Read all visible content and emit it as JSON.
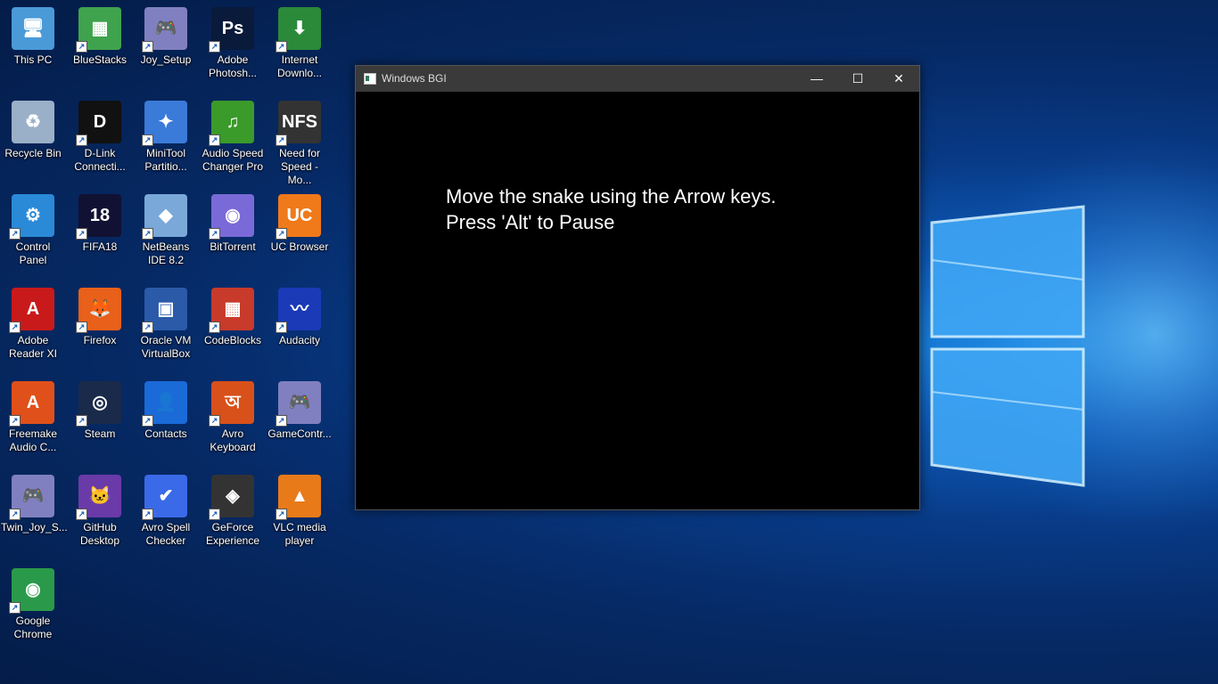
{
  "colors": {
    "desktop_bg": "#083a86",
    "window_bg": "#000000",
    "titlebar": "#3a3a3a"
  },
  "desktop_icons": [
    {
      "label": "This PC",
      "icon": "computer-icon",
      "color": "#4a9ad8",
      "glyph": "🖥"
    },
    {
      "label": "BlueStacks",
      "icon": "bluestacks-icon",
      "color": "#3fa34d",
      "glyph": "▦"
    },
    {
      "label": "Joy_Setup",
      "icon": "gamepad-icon",
      "color": "#8080c0",
      "glyph": "🎮"
    },
    {
      "label": "Adobe Photosh...",
      "icon": "photoshop-icon",
      "color": "#0a1a3a",
      "glyph": "Ps"
    },
    {
      "label": "Internet Downlo...",
      "icon": "idm-icon",
      "color": "#2a8a3a",
      "glyph": "⬇"
    },
    {
      "label": "Recycle Bin",
      "icon": "recycle-bin-icon",
      "color": "#9ab0c8",
      "glyph": "♻"
    },
    {
      "label": "D-Link Connecti...",
      "icon": "dlink-icon",
      "color": "#111111",
      "glyph": "D"
    },
    {
      "label": "MiniTool Partitio...",
      "icon": "minitool-icon",
      "color": "#3a7ad8",
      "glyph": "✦"
    },
    {
      "label": "Audio Speed Changer Pro",
      "icon": "audio-speed-icon",
      "color": "#3a9a2a",
      "glyph": "♫"
    },
    {
      "label": "Need for Speed - Mo...",
      "icon": "nfs-icon",
      "color": "#333333",
      "glyph": "NFS"
    },
    {
      "label": "Control Panel",
      "icon": "control-panel-icon",
      "color": "#2a8ad8",
      "glyph": "⚙"
    },
    {
      "label": "FIFA18",
      "icon": "fifa-icon",
      "color": "#111133",
      "glyph": "18"
    },
    {
      "label": "NetBeans IDE 8.2",
      "icon": "netbeans-icon",
      "color": "#7aa8d8",
      "glyph": "◆"
    },
    {
      "label": "BitTorrent",
      "icon": "bittorrent-icon",
      "color": "#7a6ad8",
      "glyph": "◉"
    },
    {
      "label": "UC Browser",
      "icon": "uc-browser-icon",
      "color": "#f07a1a",
      "glyph": "UC"
    },
    {
      "label": "Adobe Reader XI",
      "icon": "adobe-reader-icon",
      "color": "#c81a1a",
      "glyph": "A"
    },
    {
      "label": "Firefox",
      "icon": "firefox-icon",
      "color": "#e8601a",
      "glyph": "🦊"
    },
    {
      "label": "Oracle VM VirtualBox",
      "icon": "virtualbox-icon",
      "color": "#2a5aa8",
      "glyph": "▣"
    },
    {
      "label": "CodeBlocks",
      "icon": "codeblocks-icon",
      "color": "#c83a2a",
      "glyph": "▦"
    },
    {
      "label": "Audacity",
      "icon": "audacity-icon",
      "color": "#1a3ab8",
      "glyph": "〰"
    },
    {
      "label": "Freemake Audio C...",
      "icon": "freemake-icon",
      "color": "#e0501a",
      "glyph": "A"
    },
    {
      "label": "Steam",
      "icon": "steam-icon",
      "color": "#1a2a4a",
      "glyph": "◎"
    },
    {
      "label": "Contacts",
      "icon": "contacts-icon",
      "color": "#1a6ad8",
      "glyph": "👤"
    },
    {
      "label": "Avro Keyboard",
      "icon": "avro-keyboard-icon",
      "color": "#d8501a",
      "glyph": "অ"
    },
    {
      "label": "GameContr...",
      "icon": "gamepad-icon",
      "color": "#8080c0",
      "glyph": "🎮"
    },
    {
      "label": "Twin_Joy_S...",
      "icon": "gamepad-icon",
      "color": "#8080c0",
      "glyph": "🎮"
    },
    {
      "label": "GitHub Desktop",
      "icon": "github-icon",
      "color": "#6a3aa8",
      "glyph": "🐱"
    },
    {
      "label": "Avro Spell Checker",
      "icon": "avro-spell-icon",
      "color": "#3a6ae8",
      "glyph": "✔"
    },
    {
      "label": "GeForce Experience",
      "icon": "geforce-icon",
      "color": "#333333",
      "glyph": "◈"
    },
    {
      "label": "VLC media player",
      "icon": "vlc-icon",
      "color": "#e87a1a",
      "glyph": "▲"
    },
    {
      "label": "Google Chrome",
      "icon": "chrome-icon",
      "color": "#2a9a4a",
      "glyph": "◉"
    }
  ],
  "window": {
    "title": "Windows BGI",
    "minimize_glyph": "—",
    "maximize_glyph": "☐",
    "close_glyph": "✕",
    "line1": "Move the snake using the Arrow keys.",
    "line2": "Press 'Alt' to Pause"
  }
}
